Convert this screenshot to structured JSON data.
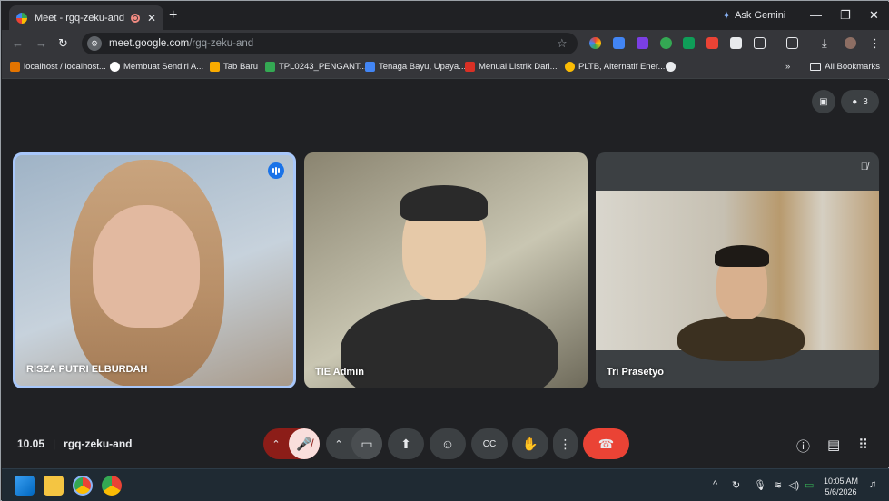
{
  "browser": {
    "tab": {
      "title": "Meet - rgq-zeku-and",
      "close": "✕"
    },
    "new_tab": "+",
    "ask_gemini": "Ask Gemini",
    "window": {
      "minimize": "—",
      "restore": "❐",
      "close": "✕"
    },
    "url": {
      "host": "meet.google.com",
      "path": "/rgq-zeku-and"
    },
    "bookmarks": [
      {
        "label": "localhost / localhost...",
        "color": "#e37400"
      },
      {
        "label": "Membuat Sendiri A...",
        "color": "#ffffff"
      },
      {
        "label": "Tab Baru",
        "color": "#f9ab00"
      },
      {
        "label": "TPL0243_PENGANT...",
        "color": "#34a853"
      },
      {
        "label": "Tenaga Bayu, Upaya...",
        "color": "#4285f4"
      },
      {
        "label": "Menuai Listrik Dari...",
        "color": "#d93025"
      },
      {
        "label": "PLTB, Alternatif Ener...",
        "color": "#fbbc04"
      }
    ],
    "overflow": "»",
    "all_bookmarks": "All Bookmarks"
  },
  "meet": {
    "participant_count": "3",
    "tiles": [
      {
        "name": "RISZA PUTRI ELBURDAH",
        "speaking": true
      },
      {
        "name": "TIE Admin",
        "speaking": false
      },
      {
        "name": "Tri Prasetyo",
        "muted": true
      }
    ],
    "time": "10.05",
    "meeting_code": "rgq-zeku-and"
  },
  "taskbar": {
    "time": "10:05 AM",
    "date": "5/6/2026",
    "tray_chevron": "^"
  },
  "colors": {
    "accent": "#a8c7fa",
    "end_call": "#ea4335",
    "mic_off": "#f9dedc"
  }
}
